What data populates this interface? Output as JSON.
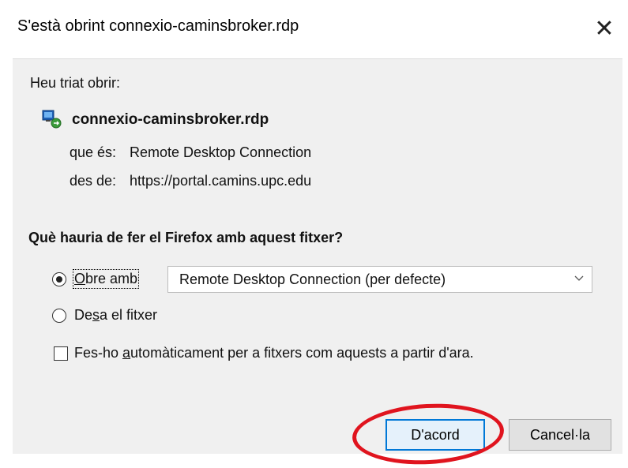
{
  "window": {
    "title": "S'està obrint connexio-caminsbroker.rdp",
    "close_glyph": "✕"
  },
  "dialog": {
    "chose_label": "Heu triat obrir:",
    "file": {
      "icon": "remote-desktop-file-icon",
      "name": "connexio-caminsbroker.rdp",
      "type_key": "que és:",
      "type_value": "Remote Desktop Connection",
      "from_key": "des de:",
      "from_value": "https://portal.camins.upc.edu"
    },
    "question": "Què hauria de fer el Firefox amb aquest fitxer?",
    "options": {
      "open_with": {
        "label_pre": "",
        "label_access": "O",
        "label_post": "bre amb",
        "checked": true
      },
      "save": {
        "label_pre": "De",
        "label_access": "s",
        "label_post": "a el fitxer",
        "checked": false
      }
    },
    "app_select": {
      "value": "Remote Desktop Connection (per defecte)"
    },
    "auto_checkbox": {
      "label_pre": "Fes-ho ",
      "label_access": "a",
      "label_post": "utomàticament per a fitxers com aquests a partir d'ara.",
      "checked": false
    },
    "buttons": {
      "ok": "D'acord",
      "cancel": "Cancel·la"
    }
  },
  "colors": {
    "annotation": "#e0141e",
    "focus_border": "#0078d7",
    "dialog_bg": "#f0f0f0"
  }
}
